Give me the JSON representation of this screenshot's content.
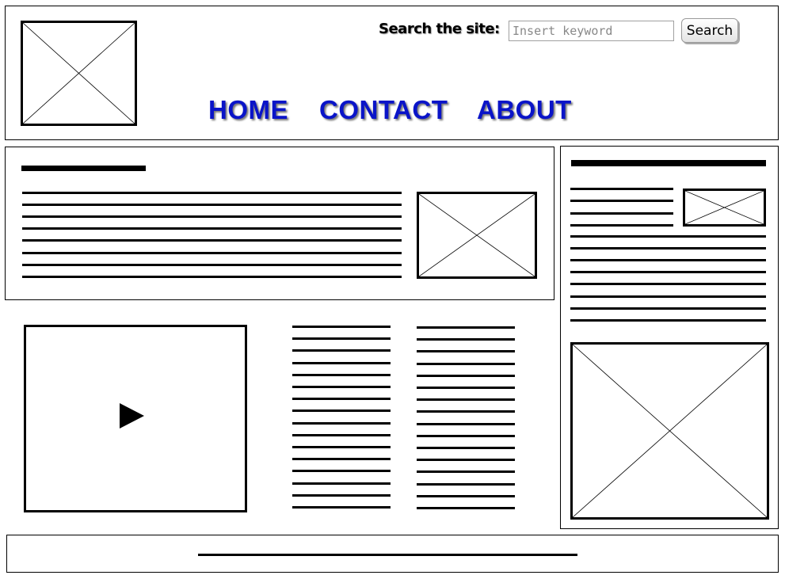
{
  "header": {
    "search": {
      "label": "Search the site:",
      "placeholder": "Insert keyword",
      "value": "",
      "button_label": "Search"
    },
    "nav": [
      {
        "label": "HOME"
      },
      {
        "label": "CONTACT"
      },
      {
        "label": "ABOUT"
      }
    ],
    "logo_icon": "image-placeholder-icon"
  },
  "main": {
    "article_image_icon": "image-placeholder-icon",
    "video_icon": "play-icon"
  },
  "sidebar": {
    "thumbnail_icon": "image-placeholder-icon",
    "large_image_icon": "image-placeholder-icon"
  },
  "colors": {
    "nav_link": "#0a14c8",
    "wireframe": "#000000",
    "background": "#ffffff"
  }
}
